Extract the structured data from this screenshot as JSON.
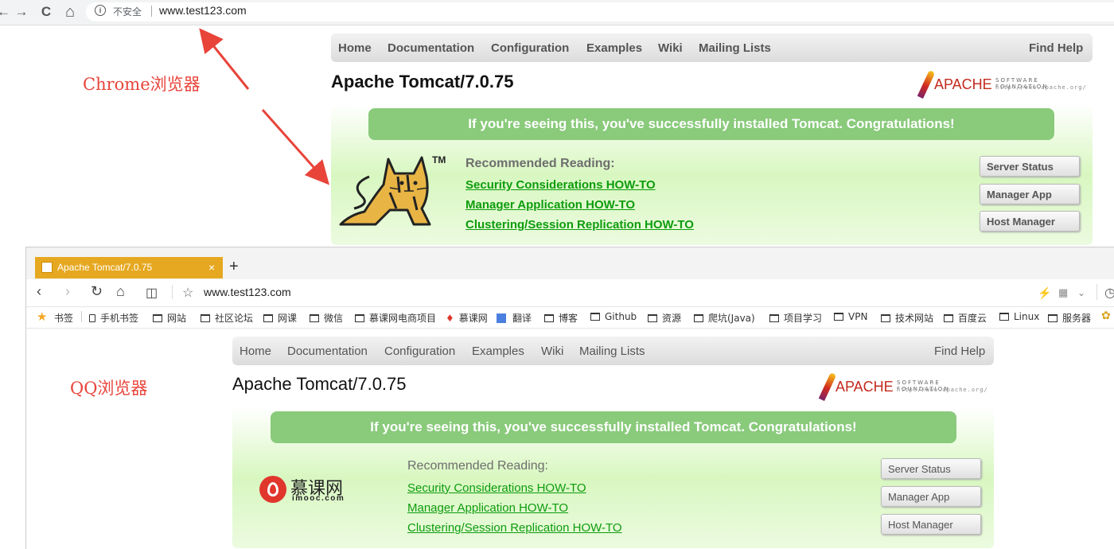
{
  "chrome": {
    "back": "←",
    "forward": "→",
    "reload": "C",
    "home": "⌂",
    "insecure_label": "不安全",
    "url": "www.test123.com"
  },
  "annotations": {
    "chrome_label": "Chrome浏览器",
    "qq_label": "QQ浏览器"
  },
  "tomcat": {
    "menu": [
      "Home",
      "Documentation",
      "Configuration",
      "Examples",
      "Wiki",
      "Mailing Lists"
    ],
    "find_help": "Find Help",
    "title": "Apache Tomcat/7.0.75",
    "apache_word": "APACHE",
    "apache_sf": "SOFTWARE FOUNDATION",
    "apache_url": "http://www.apache.org/",
    "banner": "If you're seeing this, you've successfully installed Tomcat. Congratulations!",
    "recommended": "Recommended Reading:",
    "links": [
      "Security Considerations HOW-TO",
      "Manager Application HOW-TO",
      "Clustering/Session Replication HOW-TO"
    ],
    "buttons": [
      "Server Status",
      "Manager App",
      "Host Manager"
    ],
    "tm": "TM"
  },
  "qq": {
    "tab_title": "Apache Tomcat/7.0.75",
    "tab_close": "×",
    "new_tab": "+",
    "url": "www.test123.com",
    "bookmarks_label": "书签",
    "bookmarks": [
      "手机书签",
      "网站",
      "社区论坛",
      "网课",
      "微信",
      "慕课网电商项目",
      "慕课网",
      "翻译",
      "博客",
      "Github",
      "资源",
      "爬坑(Java)",
      "项目学习",
      "VPN",
      "技术网站",
      "百度云",
      "Linux",
      "服务器"
    ],
    "mooc_name": "慕课网",
    "mooc_domain": "imooc.com"
  }
}
